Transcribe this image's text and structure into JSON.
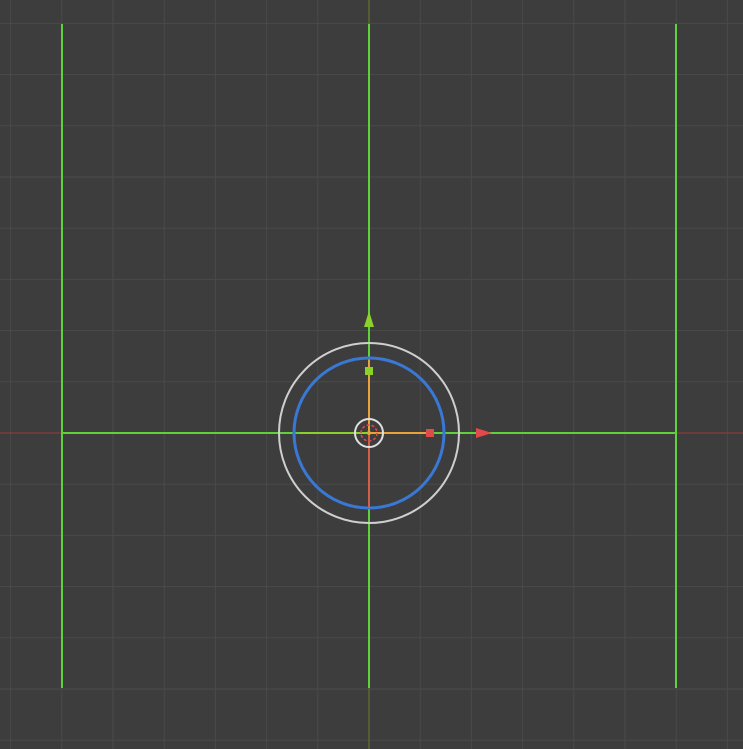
{
  "viewport": {
    "background": "#3d3d3d",
    "grid_color": "#4a4a4a",
    "x_axis_color": "#9a3a3a",
    "y_axis_color": "#6a7a2a",
    "edge_color": "#5fd23a",
    "gizmo_outer_ring_color": "#cfcfcf",
    "gizmo_rotate_ring_color": "#3a78d6",
    "gizmo_x_color": "#e04a4a",
    "gizmo_y_color": "#8ad22a",
    "gizmo_z_color": "#e8a23a",
    "gizmo_center_color": "#e0e0e0"
  },
  "gizmo": {
    "icons": [
      "move-x-arrow-icon",
      "move-y-arrow-icon",
      "scale-x-handle-icon",
      "scale-y-handle-icon",
      "rotate-ring-icon",
      "trackball-ring-icon",
      "origin-icon"
    ]
  }
}
